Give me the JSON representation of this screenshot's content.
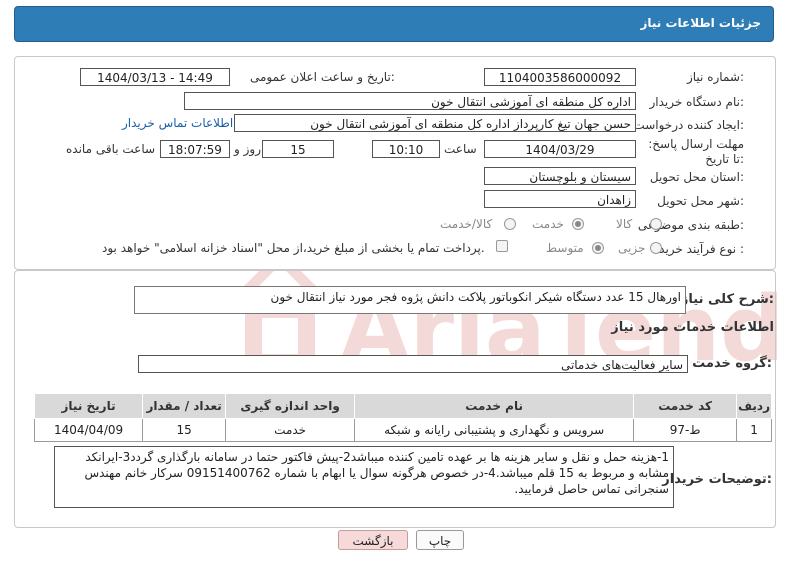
{
  "header": {
    "title": "جزئیات اطلاعات نیاز"
  },
  "fields": {
    "need_number_label": "شماره نیاز:",
    "need_number": "1104003586000092",
    "announce_label": "تاریخ و ساعت اعلان عمومی:",
    "announce_value": "1404/03/13 - 14:49",
    "buyer_org_label": "نام دستگاه خریدار:",
    "buyer_org": "اداره کل منطقه ای آموزشی انتقال خون",
    "creator_label": "ایجاد کننده درخواست:",
    "creator": "حسن جهان تیغ کارپرداز اداره کل منطقه ای آموزشی انتقال خون",
    "contact_link": "اطلاعات تماس خریدار",
    "deadline_label": "مهلت ارسال پاسخ: تا تاریخ:",
    "deadline_date": "1404/03/29",
    "hour_label": "ساعت",
    "deadline_time": "10:10",
    "days": "15",
    "day_label": "روز و",
    "remaining_time": "18:07:59",
    "remaining_label": "ساعت باقی مانده",
    "province_label": "استان محل تحویل:",
    "province": "سیستان و بلوچستان",
    "city_label": "شهر محل تحویل:",
    "city": "زاهدان",
    "category_label": "طبقه بندی موضوعی:",
    "cat_goods": "کالا",
    "cat_service": "خدمت",
    "cat_goods_service": "کالا/خدمت",
    "process_label": "نوع فرآیند خرید :",
    "proc_partial": "جزیی",
    "proc_medium": "متوسط",
    "payment_note": "پرداخت تمام یا بخشی از مبلغ خرید،از محل \"اسناد خزانه اسلامی\" خواهد بود."
  },
  "description": {
    "label": "شرح کلی نیاز:",
    "value": "اورهال 15 عدد دستگاه شیکر انکوباتور پلاکت دانش پژوه فجر مورد نیاز انتقال خون"
  },
  "services": {
    "section_title": "اطلاعات خدمات مورد نیاز",
    "group_label": "گروه خدمت:",
    "group_value": "سایر فعالیت‌های خدماتی",
    "columns": [
      "ردیف",
      "کد خدمت",
      "نام خدمت",
      "واحد اندازه گیری",
      "تعداد / مقدار",
      "تاریخ نیاز"
    ],
    "rows": [
      [
        "1",
        "ط-97",
        "سرویس و نگهداری و پشتیبانی رایانه و شبکه",
        "خدمت",
        "15",
        "1404/04/09"
      ]
    ]
  },
  "buyer_notes": {
    "label": "توضیحات خریدار:",
    "value": "1-هزینه حمل و نقل و سایر هزینه ها  بر عهده تامین کننده میباشد2-پیش فاکتور حتما در سامانه بارگذاری گردد3-ایرانکد مشابه و مربوط به 15 قلم میباشد.4-در خصوص هرگونه سوال یا ابهام با شماره 09151400762 سرکار خانم مهندس سنجرانی تماس حاصل فرمایید."
  },
  "buttons": {
    "print": "چاپ",
    "back": "بازگشت"
  },
  "watermark": {
    "text": "AriaTender.net",
    "color": "#c0392b"
  }
}
